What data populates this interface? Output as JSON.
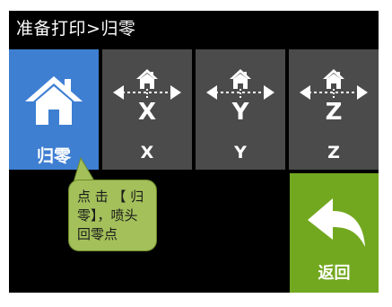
{
  "title": "准备打印>归零",
  "tiles": [
    {
      "label": "归零",
      "icon": "home-icon"
    },
    {
      "label": "X",
      "icon": "home-x-axis-icon"
    },
    {
      "label": "Y",
      "icon": "home-y-axis-icon"
    },
    {
      "label": "Z",
      "icon": "home-z-axis-icon"
    }
  ],
  "back": {
    "label": "返回",
    "icon": "back-arrow-icon"
  },
  "callout": {
    "text": "点 击 【 归零】，喷头回零点"
  },
  "colors": {
    "home_tile": "#3e7fd2",
    "axis_tile": "#4b4b4b",
    "back_button": "#72a81f",
    "callout_bg": "#a3c05a",
    "screen_bg": "#000000"
  }
}
